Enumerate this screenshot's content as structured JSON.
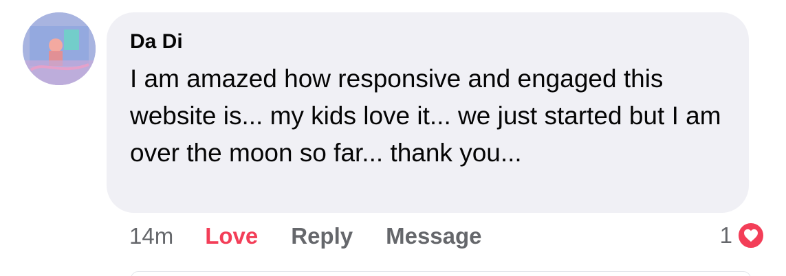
{
  "comment": {
    "author": "Da Di",
    "text": "I am amazed how responsive and engaged this website is... my kids love it... we just started but I am over the moon so far... thank you..."
  },
  "avatar": {
    "description_icon": "profile-avatar"
  },
  "actions": {
    "time": "14m",
    "love_label": "Love",
    "reply_label": "Reply",
    "message_label": "Message"
  },
  "reactions": {
    "count": "1",
    "icon": "heart-icon",
    "color": "#f33e58"
  },
  "colors": {
    "bubble": "#f0f0f5",
    "text": "#050505",
    "muted": "#65676b",
    "love": "#f33e58"
  }
}
